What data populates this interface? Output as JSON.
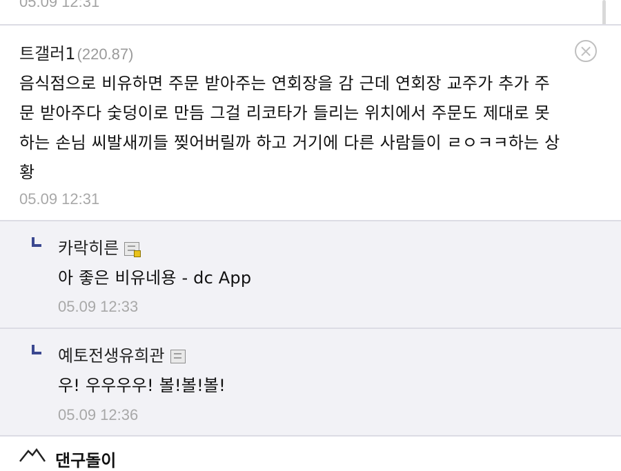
{
  "previous_comment": {
    "date": "05.09 12:31"
  },
  "comment": {
    "author": "트갤러1",
    "ip": "(220.87)",
    "body_lines": [
      "음식점으로 비유하면 주문 받아주는 연회장을 감 근데 연회장 교주가 추가 주",
      "문 받아주다 숯덩이로 만듬 그걸 리코타가 들리는 위치에서 주문도 제대로 못",
      "하는 손님 씨발새끼들 찢어버릴까 하고 거기에 다른 사람들이 ㄹㅇㅋㅋ하는 상",
      "황"
    ],
    "date": "05.09 12:31",
    "delete_icon": "close-circle-icon"
  },
  "replies": [
    {
      "author": "카락히른",
      "badge": "fixed-nick-icon-sub-manager",
      "body": "아 좋은 비유네용 - dc App",
      "date": "05.09 12:33"
    },
    {
      "author": "예토전생유희관",
      "badge": "fixed-nick-icon",
      "body": "우! 우우우우! 볼!볼!볼!",
      "date": "05.09 12:36"
    }
  ],
  "next_comment": {
    "author": "댄구돌이",
    "icon": "mountain-icon"
  }
}
